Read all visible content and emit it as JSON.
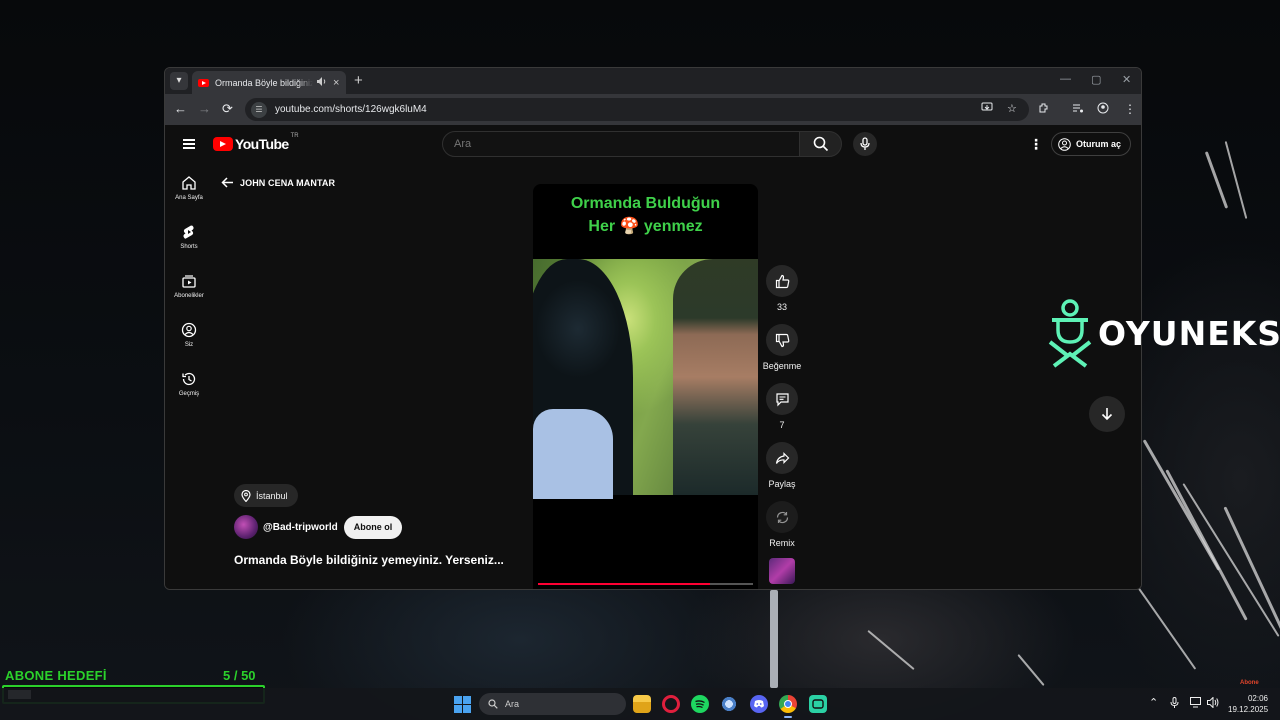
{
  "browser": {
    "tab": {
      "title": "Ormanda Böyle bildiğiniz yemeyiniz. Yerseniz...",
      "audio_icon": "speaker-icon",
      "close_glyph": "×"
    },
    "new_tab_glyph": "+",
    "window_controls": [
      "—",
      "▢",
      "✕"
    ],
    "url": "youtube.com/shorts/126wgk6luM4",
    "toolbar_icons": [
      "back-icon",
      "forward-icon",
      "reload-icon",
      "site-info-icon",
      "install-icon",
      "star-icon",
      "extensions-icon",
      "media-control-icon",
      "profile-icon",
      "menu-icon"
    ]
  },
  "youtube": {
    "logo_text": "YouTube",
    "region": "TR",
    "search_placeholder": "Ara",
    "sign_in_label": "Oturum aç",
    "guide": [
      {
        "label": "Ana Sayfa",
        "icon": "home-icon"
      },
      {
        "label": "Shorts",
        "icon": "shorts-icon"
      },
      {
        "label": "Abonelikler",
        "icon": "subscriptions-icon"
      },
      {
        "label": "Siz",
        "icon": "you-icon"
      },
      {
        "label": "Geçmiş",
        "icon": "history-icon"
      }
    ],
    "back_label": "JOHN CENA MANTAR",
    "video": {
      "caption": "Ormanda Bulduğun\nHer 🍄 yenmez",
      "progress": 0.8
    },
    "actions": {
      "like_count": "33",
      "dislike_label": "Beğenme",
      "comment_count": "7",
      "share_label": "Paylaş",
      "remix_label": "Remix"
    },
    "location": "İstanbul",
    "channel": "@Bad-tripworld",
    "subscribe_label": "Abone ol",
    "title": "Ormanda Böyle bildiğiniz yemeyiniz. Yerseniz..."
  },
  "overlay": {
    "logo_text": "OYUNEKS",
    "corner_text": "Abone"
  },
  "goal": {
    "label": "ABONE HEDEFİ",
    "count": "5  / 50",
    "current": 5,
    "target": 50
  },
  "taskbar": {
    "search_placeholder": "Ara",
    "apps": [
      "file-explorer-icon",
      "opera-icon",
      "spotify-icon",
      "steam-like-icon",
      "discord-icon",
      "chrome-icon",
      "app-icon"
    ],
    "time": "02:06",
    "date": "19.12.2025"
  },
  "colors": {
    "youtube_red": "#ff0000",
    "goal_green": "#2bd12b",
    "caption_green": "#3fd14a",
    "progress_red": "#ff0033"
  }
}
